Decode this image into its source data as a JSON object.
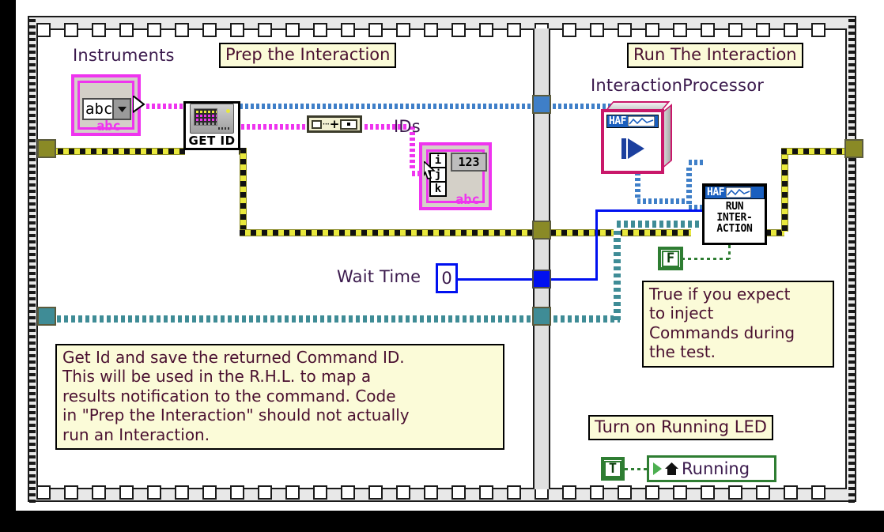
{
  "diagram": {
    "type": "labview-block-diagram",
    "structure": "flat-sequence",
    "frames": [
      {
        "caption": "Prep the Interaction"
      },
      {
        "caption": "Run The Interaction"
      }
    ]
  },
  "left_frame": {
    "caption": "Prep the Interaction",
    "instruments_control": {
      "label": "Instruments",
      "value": "abc",
      "type_tag": "abc",
      "dropdown_icon": "chevron-down-icon"
    },
    "get_id_vi": {
      "name": "GET ID",
      "icon": "instrument-icon"
    },
    "index_node": {
      "glyph": "···+"
    },
    "ids_indicator": {
      "label": "IDs",
      "index_i": "i",
      "index_j": "j",
      "index_k": "k",
      "element": "123",
      "type_tag": "abc"
    },
    "wait_time": {
      "label": "Wait Time",
      "value": "0"
    },
    "comment": "Get Id and save the returned Command ID. This will be used in the R.H.L. to map a results notification to the command.  Code in \"Prep the Interaction\" should not actually run an Interaction.",
    "comment_lines": [
      "Get Id and save the returned Command ID.",
      "This will be used in the R.H.L. to map a",
      "results notification to the command.  Code",
      "in \"Prep the Interaction\" should not actually",
      "run an Interaction."
    ]
  },
  "right_frame": {
    "caption": "Run The Interaction",
    "processor": {
      "label": "InteractionProcessor",
      "header": "HAF",
      "icon": "play-triangle-icon"
    },
    "run_interaction_node": {
      "header": "HAF",
      "line1": "RUN",
      "line2": "INTER-",
      "line3": "ACTION"
    },
    "false_constant": {
      "value": "F"
    },
    "false_comment_lines": [
      "True if you expect",
      "to inject",
      "Commands during",
      "the test."
    ],
    "led_caption": "Turn on Running LED",
    "true_constant": {
      "value": "T"
    },
    "running_property": {
      "label": "Running",
      "icons": [
        "play-triangle-icon",
        "home-icon"
      ]
    }
  },
  "colors": {
    "canvas": "#ffffff",
    "structure_border": "#1a1a1a",
    "structure_fill": "#e8e8e8",
    "caption_fill": "#fbfbd8",
    "caption_text": "#4a1030",
    "label_text": "#3b1a4d",
    "error_wire": "#e8e83c",
    "string_wire": "#ef34ef",
    "class_wire_blue": "#3f7fc8",
    "class_wire_teal": "#3f8c96",
    "numeric_wire": "#0010f0",
    "boolean_wire": "#2e7d32",
    "class_accent": "#c9186a",
    "haf_header": "#1a5fbf"
  }
}
